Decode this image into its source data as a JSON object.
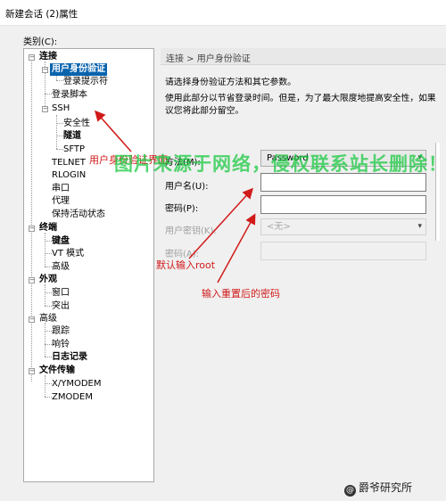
{
  "window": {
    "title": "新建会话 (2)属性"
  },
  "category_label": "类别(C):",
  "tree": {
    "conn": "连接",
    "user_auth": "用户身份验证",
    "login_prompt": "登录提示符",
    "login_script": "登录脚本",
    "ssh": "SSH",
    "security": "安全性",
    "tunnel": "隧道",
    "sftp": "SFTP",
    "telnet": "TELNET",
    "rlogin": "RLOGIN",
    "serial": "串口",
    "proxy": "代理",
    "keepalive": "保持活动状态",
    "terminal": "终端",
    "keyboard": "键盘",
    "vt_mode": "VT 模式",
    "advanced1": "高级",
    "appearance": "外观",
    "window": "窗口",
    "highlight": "突出",
    "advanced": "高级",
    "trace": "跟踪",
    "bell": "响铃",
    "logging": "日志记录",
    "file_transfer": "文件传输",
    "xymodem": "X/YMODEM",
    "zmodem": "ZMODEM"
  },
  "panel": {
    "breadcrumb": "连接 > 用户身份验证",
    "desc1": "请选择身份验证方法和其它参数。",
    "desc2": "使用此部分以节省登录时间。但是，为了最大限度地提高安全性，如果",
    "desc3": "议您将此部分留空。",
    "method_label": "方法(M):",
    "method_value": "Password",
    "username_label": "用户名(U):",
    "username_value": "",
    "password_label": "密码(P):",
    "password_value": "",
    "userkey_label": "用户密钥(K):",
    "userkey_value": "<无>",
    "passphrase_label": "密码(A):",
    "passphrase_value": ""
  },
  "annotations": {
    "auth_ui": "用户身份验证界面",
    "default_root": "默认输入root",
    "reset_pwd": "输入重置后的密码"
  },
  "watermark": {
    "main": "图片来源于网络，侵权联系站长删除！",
    "footer": "爵爷研究所"
  },
  "colors": {
    "selection": "#0a64ad",
    "annotation": "#d11a1a",
    "watermark": "#14c83c"
  }
}
